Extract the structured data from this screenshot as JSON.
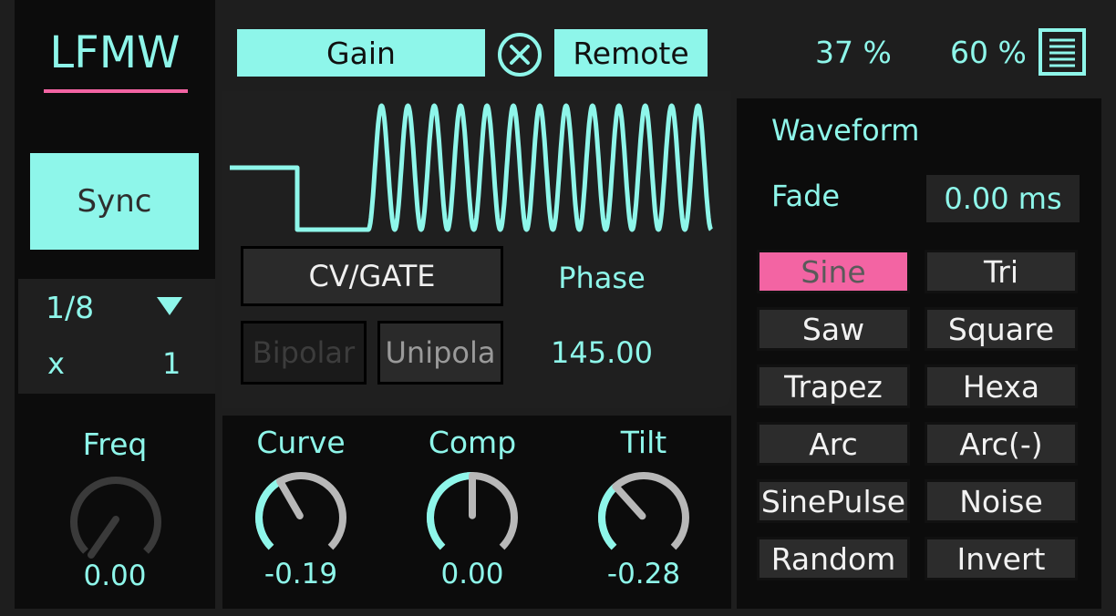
{
  "device": {
    "title": "LFMW",
    "accent": "#8ef6ea",
    "highlight": "#f364a3"
  },
  "left": {
    "sync_label": "Sync",
    "rate": "1/8",
    "rate_dropdown_icon": "triangle-down-icon",
    "multiplier_label": "x",
    "multiplier_value": "1",
    "freq_label": "Freq",
    "freq_value": "0.00"
  },
  "top": {
    "target_label": "Gain",
    "clear_icon": "close-circle-icon",
    "remote_label": "Remote",
    "percent_a": "37 %",
    "percent_b": "60 %",
    "menu_icon": "list-icon"
  },
  "display": {
    "mode_label": "CV/GATE",
    "phase_label": "Phase",
    "phase_value": "145.00",
    "bipolar_label": "Bipolar",
    "unipolar_label": "Unipola"
  },
  "knobs": [
    {
      "label": "Curve",
      "value": "-0.19"
    },
    {
      "label": "Comp",
      "value": "0.00"
    },
    {
      "label": "Tilt",
      "value": "-0.28"
    }
  ],
  "waveform": {
    "title": "Waveform",
    "fade_label": "Fade",
    "fade_value": "0.00 ms",
    "selected": "Sine",
    "buttons": [
      "Sine",
      "Tri",
      "Saw",
      "Square",
      "Trapez",
      "Hexa",
      "Arc",
      "Arc(-)",
      "SinePulse",
      "Noise",
      "Random",
      "Invert"
    ]
  }
}
